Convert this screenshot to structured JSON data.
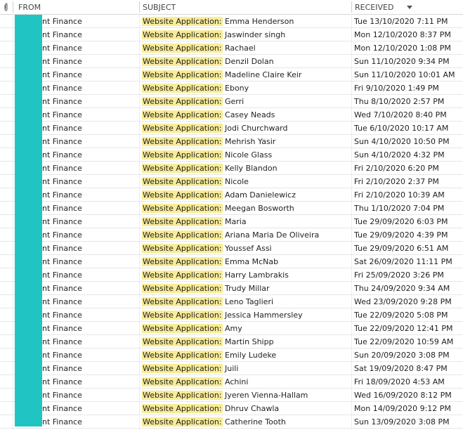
{
  "header": {
    "from_label": "FROM",
    "subject_label": "SUBJECT",
    "received_label": "RECEIVED",
    "attachment_icon": "paperclip-icon",
    "sort_icon": "sort-descending-icon"
  },
  "colors": {
    "redaction": "#20c4c2",
    "highlight": "#f8ec96"
  },
  "subject_prefix": "Website Application:",
  "rows": [
    {
      "from": "nt Finance",
      "name": "Emma Henderson",
      "received": "Tue 13/10/2020 7:11 PM"
    },
    {
      "from": "nt Finance",
      "name": "Jaswinder singh",
      "received": "Mon 12/10/2020 8:37 PM"
    },
    {
      "from": "nt Finance",
      "name": "Rachael",
      "received": "Mon 12/10/2020 1:08 PM"
    },
    {
      "from": "nt Finance",
      "name": "Denzil Dolan",
      "received": "Sun 11/10/2020 9:34 PM"
    },
    {
      "from": "nt Finance",
      "name": "Madeline Claire Keir",
      "received": "Sun 11/10/2020 10:01 AM"
    },
    {
      "from": "nt Finance",
      "name": "Ebony",
      "received": "Fri 9/10/2020 1:49 PM"
    },
    {
      "from": "nt Finance",
      "name": "Gerri",
      "received": "Thu 8/10/2020 2:57 PM"
    },
    {
      "from": "nt Finance",
      "name": "Casey Neads",
      "received": "Wed 7/10/2020 8:40 PM"
    },
    {
      "from": "nt Finance",
      "name": "Jodi Churchward",
      "received": "Tue 6/10/2020 10:17 AM"
    },
    {
      "from": "nt Finance",
      "name": "Mehrish Yasir",
      "received": "Sun 4/10/2020 10:50 PM"
    },
    {
      "from": "nt Finance",
      "name": "Nicole Glass",
      "received": "Sun 4/10/2020 4:32 PM"
    },
    {
      "from": "nt Finance",
      "name": "Kelly Blandon",
      "received": "Fri 2/10/2020 6:20 PM"
    },
    {
      "from": "nt Finance",
      "name": "Nicole",
      "received": "Fri 2/10/2020 2:37 PM"
    },
    {
      "from": "nt Finance",
      "name": "Adam Danielewicz",
      "received": "Fri 2/10/2020 10:39 AM"
    },
    {
      "from": "nt Finance",
      "name": "Meegan Bosworth",
      "received": "Thu 1/10/2020 7:04 PM"
    },
    {
      "from": "nt Finance",
      "name": "Maria",
      "received": "Tue 29/09/2020 6:03 PM"
    },
    {
      "from": "nt Finance",
      "name": "Ariana Maria De Oliveira",
      "received": "Tue 29/09/2020 4:39 PM"
    },
    {
      "from": "nt Finance",
      "name": "Youssef Assi",
      "received": "Tue 29/09/2020 6:51 AM"
    },
    {
      "from": "nt Finance",
      "name": "Emma McNab",
      "received": "Sat 26/09/2020 11:11 PM"
    },
    {
      "from": "nt Finance",
      "name": "Harry Lambrakis",
      "received": "Fri 25/09/2020 3:26 PM"
    },
    {
      "from": "nt Finance",
      "name": "Trudy Millar",
      "received": "Thu 24/09/2020 9:34 AM"
    },
    {
      "from": "nt Finance",
      "name": "Leno Taglieri",
      "received": "Wed 23/09/2020 9:28 PM"
    },
    {
      "from": "nt Finance",
      "name": "Jessica Hammersley",
      "received": "Tue 22/09/2020 5:08 PM"
    },
    {
      "from": "nt Finance",
      "name": "Amy",
      "received": "Tue 22/09/2020 12:41 PM"
    },
    {
      "from": "nt Finance",
      "name": "Martin Shipp",
      "received": "Tue 22/09/2020 10:59 AM"
    },
    {
      "from": "nt Finance",
      "name": "Emily Ludeke",
      "received": "Sun 20/09/2020 3:08 PM"
    },
    {
      "from": "nt Finance",
      "name": "Juili",
      "received": "Sat 19/09/2020 8:47 PM"
    },
    {
      "from": "nt Finance",
      "name": "Achini",
      "received": "Fri 18/09/2020 4:53 AM"
    },
    {
      "from": "nt Finance",
      "name": "Jyeren Vienna-Hallam",
      "received": "Wed 16/09/2020 8:12 PM"
    },
    {
      "from": "nt Finance",
      "name": "Dhruv Chawla",
      "received": "Mon 14/09/2020 9:12 PM"
    },
    {
      "from": "nt Finance",
      "name": "Catherine Tooth",
      "received": "Sun 13/09/2020 3:08 PM"
    }
  ]
}
